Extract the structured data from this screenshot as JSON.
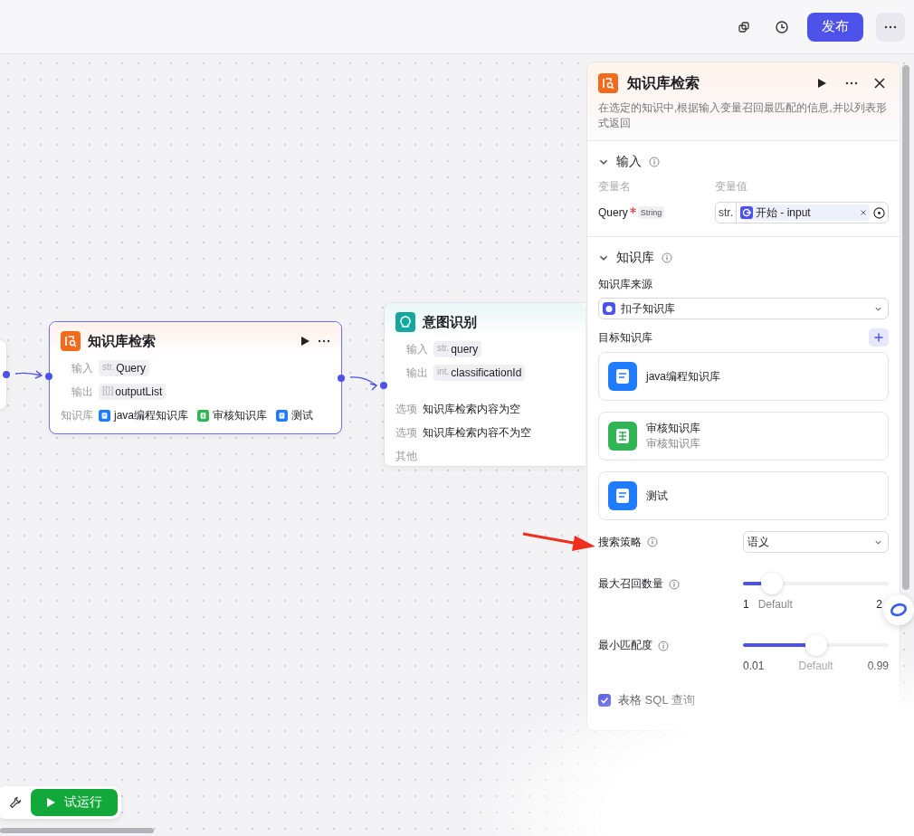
{
  "toolbar": {
    "publish": "发布"
  },
  "canvas": {
    "nodes": [
      {
        "kind": "knowledge",
        "title": "知识库检索",
        "selected": true,
        "rows": [
          {
            "label": "输入",
            "type": "str.",
            "value": "Query"
          },
          {
            "label": "输出",
            "type": "[{}]",
            "value": "outputList"
          }
        ],
        "kb_label": "知识库",
        "kbs": [
          {
            "name": "java编程知识库",
            "color": "#1f7cff"
          },
          {
            "name": "审核知识库",
            "color": "#31b454"
          },
          {
            "name": "测试",
            "color": "#1f7cff"
          }
        ]
      },
      {
        "kind": "intent",
        "title": "意图识别",
        "selected": false,
        "rows": [
          {
            "label": "输入",
            "type": "str.",
            "value": "query"
          },
          {
            "label": "输出",
            "type": "int.",
            "value": "classificationId"
          }
        ],
        "options": [
          {
            "label": "选项",
            "text": "知识库检索内容为空"
          },
          {
            "label": "选项",
            "text": "知识库检索内容不为空"
          },
          {
            "label": "其他"
          }
        ]
      }
    ],
    "trial_run": "试运行"
  },
  "panel": {
    "title": "知识库检索",
    "description": "在选定的知识中,根据输入变量召回最匹配的信息,并以列表形式返回",
    "input": {
      "title": "输入",
      "expanded": true,
      "name_header": "变量名",
      "value_header": "变量值",
      "variable": {
        "name": "Query",
        "required": true,
        "type": "String",
        "value_type": "str.",
        "value": "开始 - input"
      }
    },
    "knowledge": {
      "title": "知识库",
      "expanded": true,
      "source_label": "知识库来源",
      "source": "扣子知识库",
      "target_label": "目标知识库",
      "kbs": [
        {
          "name": "java编程知识库",
          "color": "#1f7cff"
        },
        {
          "name": "审核知识库",
          "subtitle": "审核知识库",
          "color": "#31b454"
        },
        {
          "name": "测试",
          "color": "#1f7cff"
        }
      ]
    },
    "strategy": {
      "label": "搜索策略",
      "value": "语义"
    },
    "sliders": [
      {
        "label": "最大召回数量",
        "level": 0.2,
        "min": "1",
        "default": "Default",
        "max": "2"
      },
      {
        "label": "最小匹配度",
        "level": 0.5,
        "min": "0.01",
        "default": "Default",
        "max": "0.99"
      }
    ],
    "sql": {
      "label": "表格 SQL 查询",
      "checked": true
    }
  }
}
